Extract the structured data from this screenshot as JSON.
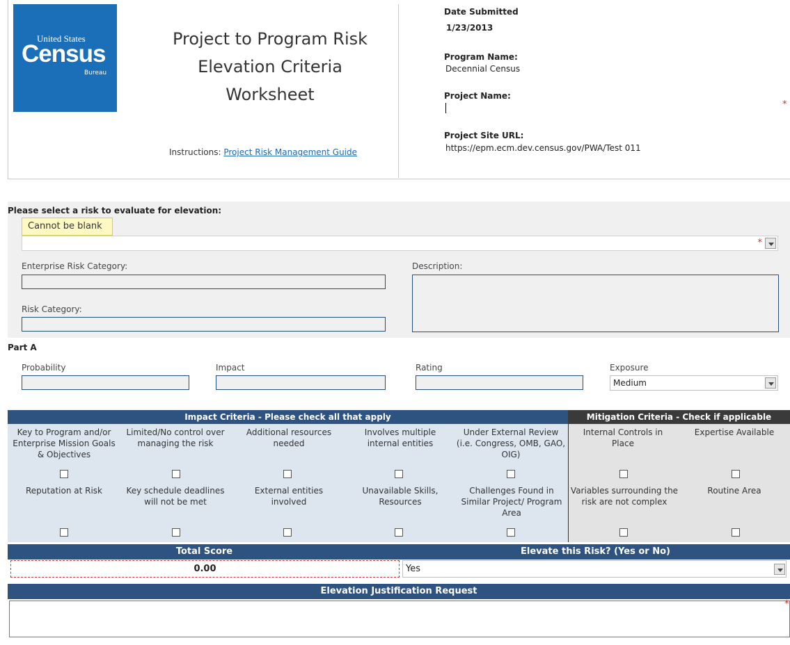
{
  "header": {
    "logo": {
      "line1": "United States",
      "line2": "Census",
      "line3": "Bureau"
    },
    "title_lines": [
      "Project to Program Risk",
      "Elevation Criteria",
      "Worksheet"
    ],
    "instructions_label": "Instructions:",
    "instructions_link": "Project Risk Management Guide",
    "date_submitted_label": "Date Submitted",
    "date_submitted_value": "1/23/2013",
    "program_name_label": "Program Name:",
    "program_name_value": "Decennial Census",
    "project_name_label": "Project Name:",
    "project_name_value": "",
    "project_site_label": "Project Site URL:",
    "project_site_value": "https://epm.ecm.dev.census.gov/PWA/Test 011",
    "required_mark": "*"
  },
  "risk_select": {
    "prompt": "Please select a risk to evaluate for elevation:",
    "validation_tooltip": "Cannot be blank",
    "selected_value": "",
    "required_mark": "*"
  },
  "risk_details": {
    "enterprise_risk_category_label": "Enterprise Risk Category:",
    "risk_category_label": "Risk Category:",
    "description_label": "Description:"
  },
  "part_a": {
    "label": "Part A",
    "probability_label": "Probability",
    "impact_label": "Impact",
    "rating_label": "Rating",
    "exposure_label": "Exposure",
    "exposure_value": "Medium"
  },
  "impact_criteria": {
    "header": "Impact Criteria - Please check all that apply",
    "row1": [
      "Key to Program and/or Enterprise Mission Goals & Objectives",
      "Limited/No control over managing the risk",
      "Additional resources needed",
      "Involves multiple internal entities",
      "Under External Review (i.e. Congress, OMB, GAO, OIG)"
    ],
    "row2": [
      "Reputation at Risk",
      "Key schedule deadlines will not be met",
      "External entities involved",
      "Unavailable Skills, Resources",
      "Challenges Found in Similar Project/ Program Area"
    ]
  },
  "mitigation_criteria": {
    "header": "Mitigation Criteria - Check if applicable",
    "row1": [
      "Internal Controls in Place",
      "Expertise Available"
    ],
    "row2": [
      "Variables surrounding the risk are not complex",
      "Routine Area"
    ]
  },
  "total_score": {
    "label": "Total Score",
    "value": "0.00"
  },
  "elevate": {
    "label": "Elevate this Risk? (Yes or No)",
    "value": "Yes"
  },
  "justification": {
    "label": "Elevation Justification Request",
    "value": "",
    "required_mark": "*"
  },
  "colors": {
    "bar": "#2e5380",
    "impact_bg": "#dde6ef",
    "mitigation_header": "#3a3a3a",
    "logo": "#1b6fb8"
  }
}
